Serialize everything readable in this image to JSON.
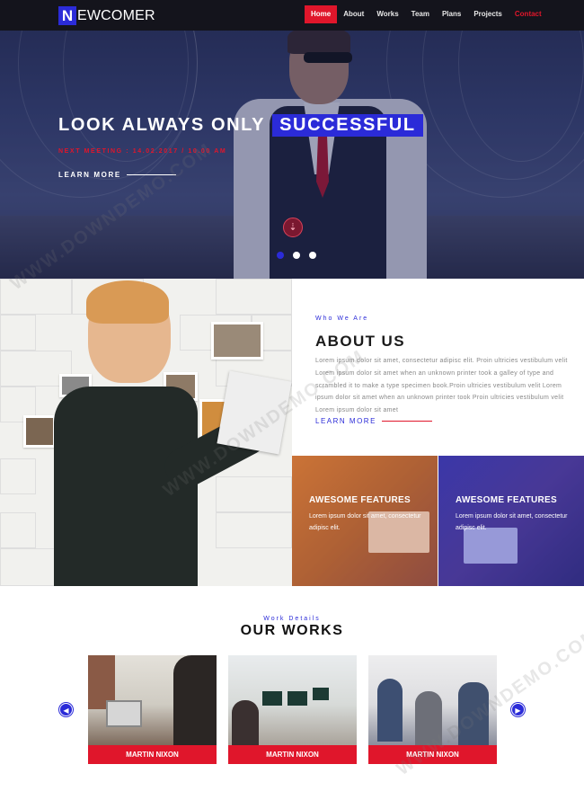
{
  "brand": {
    "mark": "N",
    "name": "EWCOMER"
  },
  "nav": {
    "items": [
      {
        "label": "Home"
      },
      {
        "label": "About"
      },
      {
        "label": "Works"
      },
      {
        "label": "Team"
      },
      {
        "label": "Plans"
      },
      {
        "label": "Projects"
      },
      {
        "label": "Contact"
      }
    ],
    "active_index": 0
  },
  "hero": {
    "title_main": "LOOK ALWAYS ONLY",
    "title_highlight": "SUCCESSFUL",
    "subtitle": "NEXT MEETING : 14.02.2017 / 10.00 AM",
    "learn_more": "LEARN MORE",
    "scroll_icon": "arrow-down-icon",
    "slides": 3,
    "active_slide": 1
  },
  "about": {
    "kicker": "Who We Are",
    "title": "ABOUT US",
    "body": "Lorem ipsum dolor sit amet, consectetur adipisc elit. Proin ultricies vestibulum velit Lorem ipsum dolor sit amet when an unknown printer took a galley of type and scrambled it to make a type specimen book.Proin ultricies vestibulum velit Lorem ipsum dolor sit amet when an unknown printer took Proin ultricies vestibulum velit Lorem ipsum dolor sit amet",
    "learn_more": "LEARN MORE"
  },
  "features": [
    {
      "title": "AWESOME FEATURES",
      "desc": "Lorem ipsum dolor sit amet, consectetur adipisc elit."
    },
    {
      "title": "AWESOME FEATURES",
      "desc": "Lorem ipsum dolor sit amet, consectetur adipisc elit."
    }
  ],
  "works": {
    "kicker": "Work Details",
    "title": "OUR WORKS",
    "cards": [
      {
        "caption": "MARTIN NIXON"
      },
      {
        "caption": "MARTIN NIXON"
      },
      {
        "caption": "MARTIN NIXON"
      }
    ],
    "prev_icon": "arrow-left-icon",
    "next_icon": "arrow-right-icon"
  },
  "watermark": "WWW.DOWNDEMO.COM",
  "colors": {
    "accent_blue": "#2b2bd8",
    "accent_red": "#e0162b",
    "nav_bg": "#14141c"
  }
}
